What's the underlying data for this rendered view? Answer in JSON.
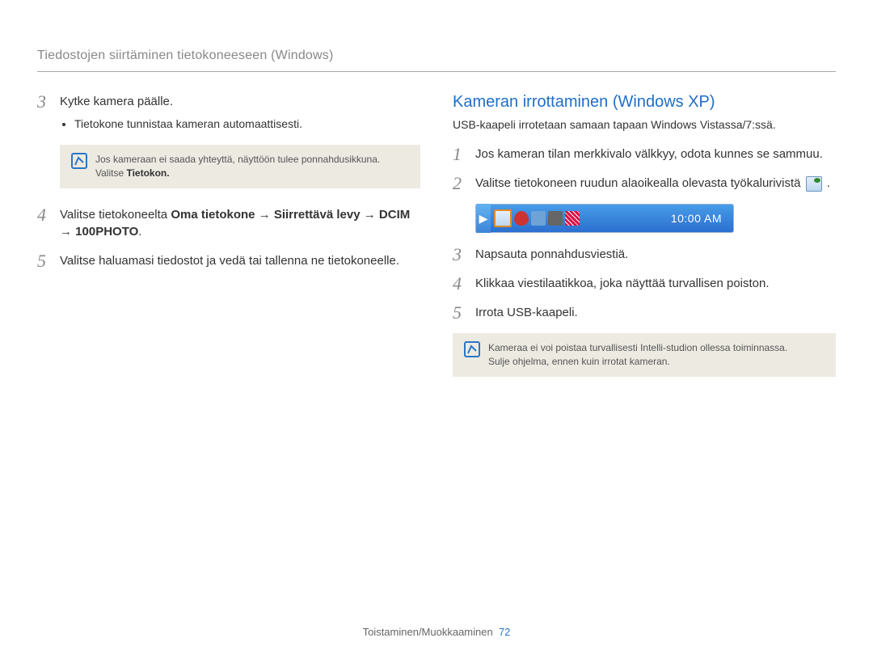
{
  "header": "Tiedostojen siirtäminen tietokoneeseen (Windows)",
  "left": {
    "step3": {
      "num": "3",
      "text": "Kytke kamera päälle.",
      "bullet": "Tietokone tunnistaa kameran automaattisesti."
    },
    "note1": {
      "line1": "Jos kameraan ei saada yhteyttä, näyttöön tulee ponnahdusikkuna.",
      "line2_pre": "Valitse ",
      "line2_bold": "Tietokon."
    },
    "step4": {
      "num": "4",
      "pre": "Valitse tietokoneelta ",
      "bold": "Oma tietokone → Siirrettävä levy → DCIM → 100PHOTO",
      "post": "."
    },
    "step5": {
      "num": "5",
      "text": "Valitse haluamasi tiedostot ja vedä tai tallenna ne tietokoneelle."
    }
  },
  "right": {
    "title": "Kameran irrottaminen (Windows XP)",
    "subtitle": "USB-kaapeli irrotetaan samaan tapaan Windows Vistassa/7:ssä.",
    "step1": {
      "num": "1",
      "text": "Jos kameran tilan merkkivalo välkkyy, odota kunnes se sammuu."
    },
    "step2": {
      "num": "2",
      "pre": "Valitse tietokoneen ruudun alaoikealla olevasta työkalurivistä ",
      "post": " ."
    },
    "taskbar_clock": "10:00 AM",
    "step3": {
      "num": "3",
      "text": "Napsauta ponnahdusviestiä."
    },
    "step4": {
      "num": "4",
      "text": "Klikkaa viestilaatikkoa, joka näyttää turvallisen poiston."
    },
    "step5": {
      "num": "5",
      "text": "Irrota USB-kaapeli."
    },
    "note2": {
      "line1": "Kameraa ei voi poistaa turvallisesti Intelli-studion ollessa toiminnassa.",
      "line2": "Sulje ohjelma, ennen kuin irrotat kameran."
    }
  },
  "footer": {
    "section": "Toistaminen/Muokkaaminen",
    "page": "72"
  }
}
